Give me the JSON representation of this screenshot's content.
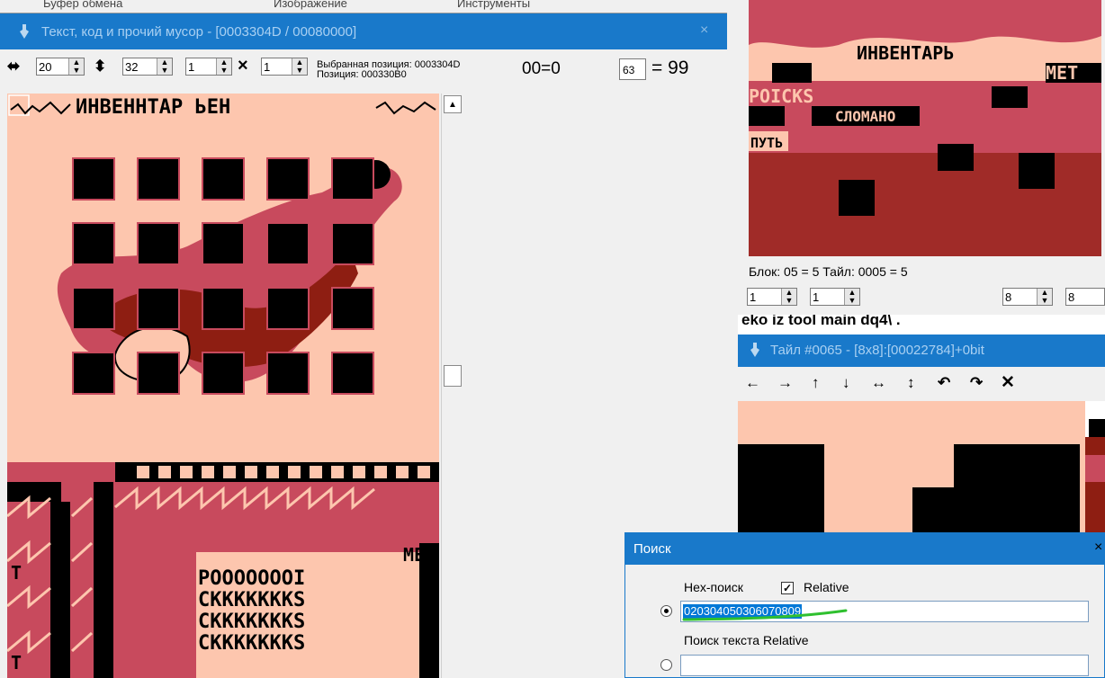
{
  "menu": {
    "items": [
      "Буфер обмена",
      "Изображение",
      "Инструменты"
    ]
  },
  "main_window": {
    "title": "Текст, код и прочий мусор - [0003304D / 00080000]",
    "close": "×"
  },
  "toolbar": {
    "width_value": "20",
    "height_value": "32",
    "cols_value": "1",
    "rows_value": "1",
    "multiply_symbol": "×",
    "selected_position": "Выбранная позиция: 0003304D",
    "position": "Позиция: 000330B0",
    "hex_readout": "00=0",
    "value_box": "63",
    "value_result": "= 99"
  },
  "tile_view": {
    "header_text": "ИНВЕННТАР ЬЕН"
  },
  "preview": {
    "header_text": "ИНВЕНТАРЬ",
    "label_broken": "СЛОМАНО",
    "label_path": "ПУТЬ",
    "label_points": "POICKS",
    "label_met": "МЕТ",
    "status": "Блок: 05 = 5  Тайл: 0005 = 5",
    "spin1": "1",
    "spin2": "1",
    "spin3": "8",
    "spin4": "8"
  },
  "tile_window": {
    "behind_text": "eko iz tool main dq4\\ .",
    "title": "Тайл #0065 - [8x8]:[00022784]+0bit",
    "tools": [
      "←",
      "→",
      "↑",
      "↓",
      "↔",
      "↕",
      "↶",
      "↷",
      "✕"
    ]
  },
  "search_dialog": {
    "title": "Поиск",
    "close": "×",
    "hex_label": "Hex-поиск",
    "relative_label": "Relative",
    "hex_value": "020304050306070809",
    "text_search_label": "Поиск текста Relative",
    "text_value": ""
  },
  "colors": {
    "titlebar": "#1979ca",
    "peach": "#fdc6ae",
    "rose": "#c84a5d",
    "dark_red": "#8e1e12",
    "highlight": "#0078d7",
    "underline": "#2fc02f"
  }
}
